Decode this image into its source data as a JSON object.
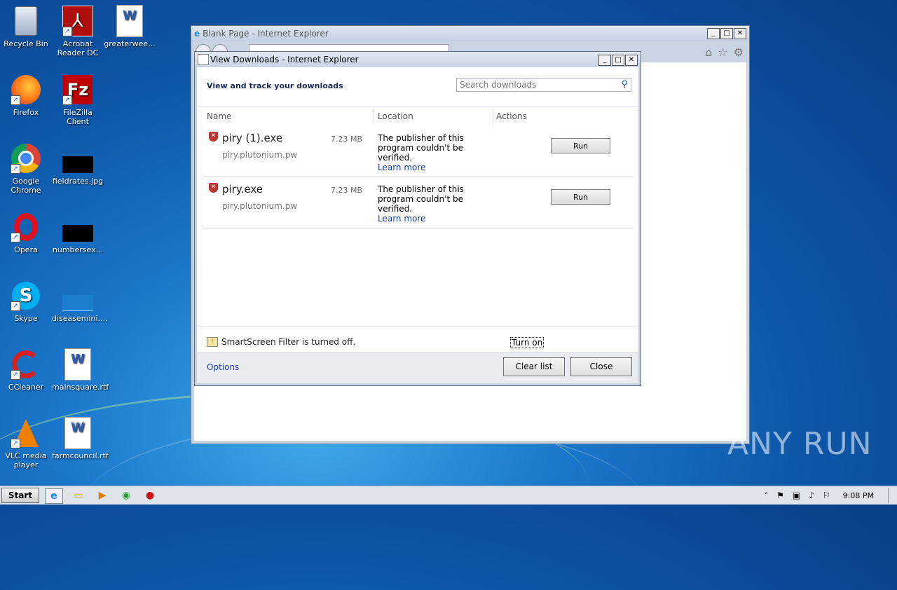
{
  "desktop_icons": [
    {
      "label": "Recycle Bin",
      "icon": "recycle-bin-icon"
    },
    {
      "label": "Acrobat\nReader DC",
      "icon": "acrobat-icon"
    },
    {
      "label": "greaterwee...",
      "icon": "word-doc-icon"
    },
    {
      "label": "Firefox",
      "icon": "firefox-icon"
    },
    {
      "label": "FileZilla Client",
      "icon": "filezilla-icon"
    },
    {
      "label": "Google\nChrome",
      "icon": "chrome-icon"
    },
    {
      "label": "fieldrates.jpg",
      "icon": "image-file-icon"
    },
    {
      "label": "Opera",
      "icon": "opera-icon"
    },
    {
      "label": "numbersex...",
      "icon": "image-file-icon"
    },
    {
      "label": "Skype",
      "icon": "skype-icon"
    },
    {
      "label": "diseasemini....",
      "icon": "image-file-icon"
    },
    {
      "label": "CCleaner",
      "icon": "ccleaner-icon"
    },
    {
      "label": "mainsquare.rtf",
      "icon": "word-doc-icon"
    },
    {
      "label": "VLC media\nplayer",
      "icon": "vlc-icon"
    },
    {
      "label": "farmcouncil.rtf",
      "icon": "word-doc-icon"
    }
  ],
  "ie_window": {
    "title": "Blank Page - Internet Explorer"
  },
  "dialog": {
    "title": "View Downloads - Internet Explorer",
    "heading": "View and track your downloads",
    "search_placeholder": "Search downloads",
    "columns": {
      "name": "Name",
      "location": "Location",
      "actions": "Actions"
    },
    "downloads": [
      {
        "name": "piry (1).exe",
        "host": "piry.plutonium.pw",
        "size": "7.23 MB",
        "msg1": "The publisher of this",
        "msg2": "program couldn't be",
        "msg3": "verified.",
        "learn_more": "Learn more",
        "action": "Run"
      },
      {
        "name": "piry.exe",
        "host": "piry.plutonium.pw",
        "size": "7.23 MB",
        "msg1": "The publisher of this",
        "msg2": "program couldn't be",
        "msg3": "verified.",
        "learn_more": "Learn more",
        "action": "Run"
      }
    ],
    "smartscreen_text": "SmartScreen Filter is turned off.",
    "turn_on": "Turn on",
    "options": "Options",
    "clear_list": "Clear list",
    "close": "Close"
  },
  "taskbar": {
    "start": "Start",
    "clock": "9:08 PM"
  },
  "watermark": "ANY RUN"
}
